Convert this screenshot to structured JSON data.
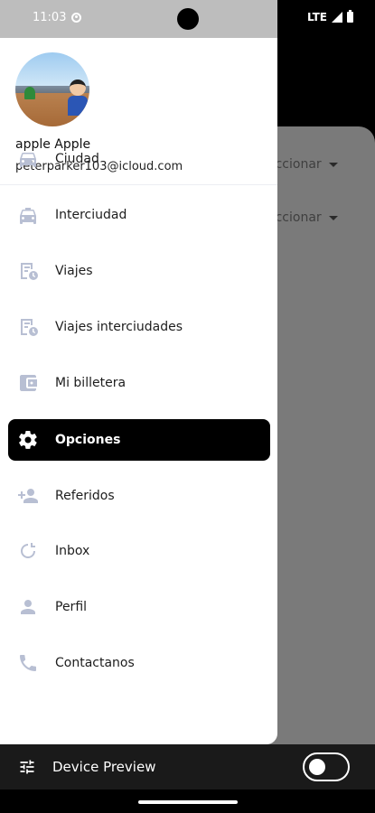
{
  "status": {
    "time": "11:03",
    "network": "LTE"
  },
  "background": {
    "select_1": "eccionar",
    "select_2": "eccionar"
  },
  "profile": {
    "name": "apple Apple",
    "email": "peterparker103@icloud.com"
  },
  "menu": [
    {
      "label": "Ciudad",
      "icon": "car-icon"
    },
    {
      "label": "Interciudad",
      "icon": "taxi-icon"
    },
    {
      "label": "Viajes",
      "icon": "trip-history-icon"
    },
    {
      "label": "Viajes interciudades",
      "icon": "intercity-history-icon"
    },
    {
      "label": "Mi billetera",
      "icon": "wallet-icon"
    },
    {
      "label": "Opciones",
      "icon": "gear-icon",
      "active": true
    },
    {
      "label": "Referidos",
      "icon": "referral-icon"
    },
    {
      "label": "Inbox",
      "icon": "inbox-icon"
    },
    {
      "label": "Perfil",
      "icon": "person-icon"
    },
    {
      "label": "Contactanos",
      "icon": "phone-icon"
    }
  ],
  "preview": {
    "label": "Device Preview",
    "toggle_on": false
  },
  "colors": {
    "icon_muted": "#b8bfd3",
    "active_bg": "#000000"
  }
}
